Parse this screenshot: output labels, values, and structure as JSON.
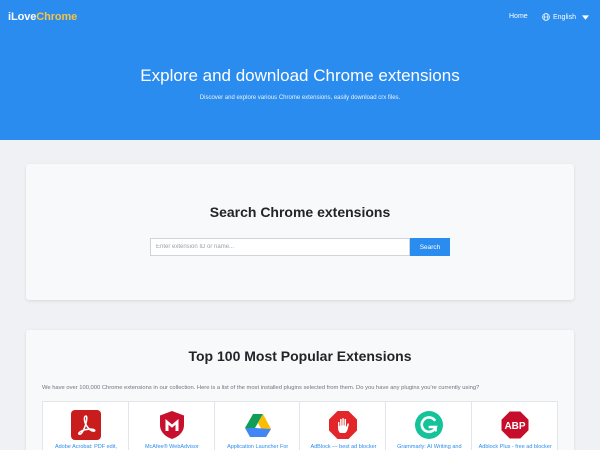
{
  "navbar": {
    "brand_main": "iLove",
    "brand_accent": "Chrome",
    "home_label": "Home",
    "language_label": "English"
  },
  "hero": {
    "title": "Explore and download Chrome extensions",
    "subtitle": "Discover and explore various Chrome extensions, easily download crx files."
  },
  "search": {
    "title": "Search Chrome extensions",
    "placeholder": "Enter extension ID or name...",
    "button_label": "Search"
  },
  "top": {
    "title": "Top 100 Most Popular Extensions",
    "description": "We have over 100,000 Chrome extensions in our collection. Here is a list of the most installed plugins selected from them. Do you have any plugins you're currently using?",
    "extensions": [
      {
        "name": "Adobe Acrobat: PDF edit,",
        "icon": "adobe-acrobat-icon"
      },
      {
        "name": "McAfee® WebAdvisor",
        "icon": "mcafee-icon"
      },
      {
        "name": "Application Launcher For",
        "icon": "google-drive-icon"
      },
      {
        "name": "AdBlock — best ad blocker",
        "icon": "adblock-icon"
      },
      {
        "name": "Grammarly: AI Writing and",
        "icon": "grammarly-icon"
      },
      {
        "name": "Adblock Plus - free ad blocker",
        "icon": "adblock-plus-icon"
      }
    ]
  },
  "colors": {
    "primary": "#2b8cef",
    "brand_accent": "#f6c343",
    "page_background": "#f0f1f4"
  }
}
